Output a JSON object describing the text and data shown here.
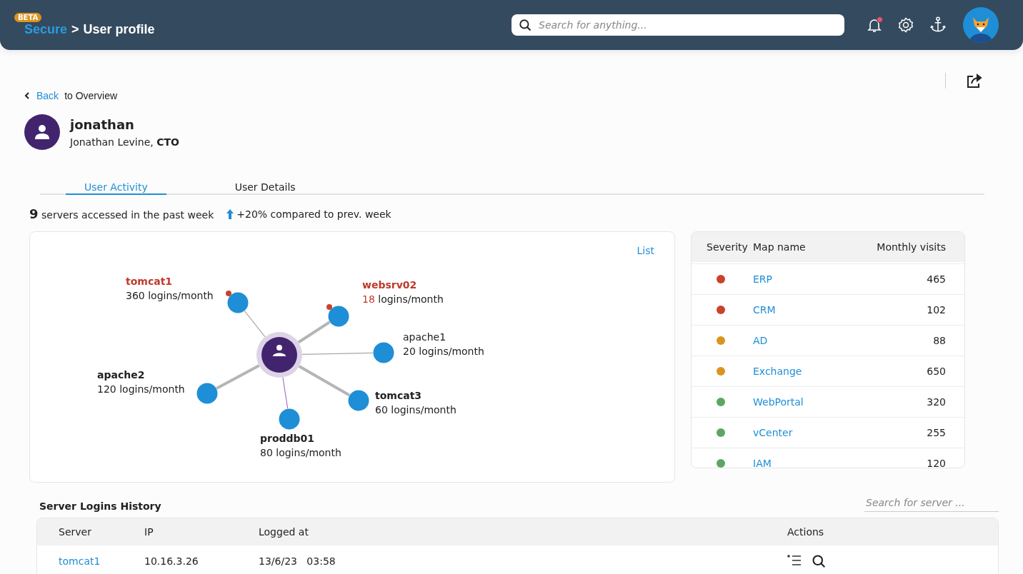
{
  "header": {
    "badge": "BETA",
    "breadcrumb_root": "Secure",
    "breadcrumb_separator": ">",
    "title": "User profile",
    "search_placeholder": "Search for anything...",
    "notification_unread": true
  },
  "back": {
    "link": "Back",
    "text": "to Overview"
  },
  "user": {
    "username": "jonathan",
    "description": "Jonathan Levine, **CTO**"
  },
  "tabs": [
    {
      "label": "User Activity",
      "selected": true
    },
    {
      "label": "User Details",
      "selected": false
    }
  ],
  "summary": {
    "count": "9",
    "text": "servers accessed in the past week",
    "trend": "+20% compared to prev. week"
  },
  "graph": {
    "list_link": "List",
    "nodes": [
      {
        "name": "tomcat1",
        "name_alert": true,
        "name_bold": true,
        "count": "360",
        "suffix": " logins/month",
        "count_alert": false,
        "alert": true,
        "link_thick": false,
        "link_highlighted": false
      },
      {
        "name": "websrv02",
        "name_alert": true,
        "name_bold": true,
        "count": "18",
        "suffix": " logins/month",
        "count_alert": true,
        "alert": true,
        "link_thick": true,
        "link_highlighted": false
      },
      {
        "name": "apache1",
        "name_alert": false,
        "name_bold": false,
        "count": "20",
        "suffix": " logins/month",
        "count_alert": false,
        "alert": false,
        "link_thick": false,
        "link_highlighted": false
      },
      {
        "name": "apache2",
        "name_alert": false,
        "name_bold": true,
        "count": "120",
        "suffix": " logins/month",
        "count_alert": false,
        "alert": false,
        "link_thick": true,
        "link_highlighted": false
      },
      {
        "name": "tomcat3",
        "name_alert": false,
        "name_bold": true,
        "count": "60",
        "suffix": " logins/month",
        "count_alert": false,
        "alert": false,
        "link_thick": true,
        "link_highlighted": false
      },
      {
        "name": "proddb01",
        "name_alert": false,
        "name_bold": true,
        "count": "80",
        "suffix": " logins/month",
        "count_alert": false,
        "alert": false,
        "link_thick": false,
        "link_highlighted": true
      }
    ]
  },
  "severity_table": {
    "columns": [
      "Severity",
      "Map name",
      "Monthly visits"
    ],
    "rows": [
      {
        "color": "#c8432b",
        "map": "ERP",
        "visits": "465"
      },
      {
        "color": "#c8432b",
        "map": "CRM",
        "visits": "102"
      },
      {
        "color": "#d9951f",
        "map": "AD",
        "visits": "88"
      },
      {
        "color": "#d9951f",
        "map": "Exchange",
        "visits": "650"
      },
      {
        "color": "#5aa764",
        "map": "WebPortal",
        "visits": "320"
      },
      {
        "color": "#5aa764",
        "map": "vCenter",
        "visits": "255"
      },
      {
        "color": "#5aa764",
        "map": "IAM",
        "visits": "120"
      }
    ]
  },
  "history": {
    "title": "Server Logins History",
    "search_placeholder": "Search for server ...",
    "columns": [
      "Server",
      "IP",
      "Logged at",
      "Actions"
    ],
    "rows": [
      {
        "server": "tomcat1",
        "ip": "10.16.3.26",
        "date": "13/6/23",
        "time": "03:58"
      }
    ]
  }
}
